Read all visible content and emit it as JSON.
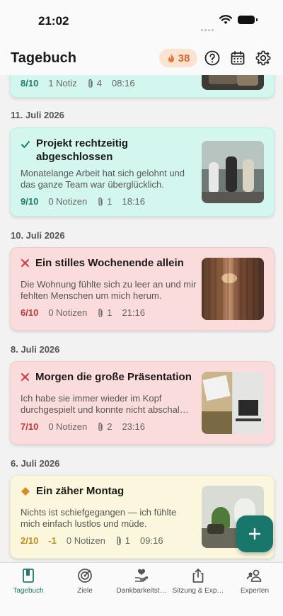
{
  "status_bar": {
    "time": "21:02"
  },
  "header": {
    "title": "Tagebuch",
    "streak_count": "38"
  },
  "entries": [
    {
      "title": "",
      "description": "",
      "score": "8/10",
      "notes": "1 Notiz",
      "attachments": "4",
      "time": "08:16",
      "mood": "positive"
    },
    {
      "date": "11. Juli 2026",
      "title": "Projekt rechtzeitig abgeschlossen",
      "description": "Monatelange Arbeit hat sich gelohnt und das ganze Team war überglücklich.",
      "score": "9/10",
      "notes": "0 Notizen",
      "attachments": "1",
      "time": "18:16",
      "mood": "positive"
    },
    {
      "date": "10. Juli 2026",
      "title": "Ein stilles Wochenende allein",
      "description": "Die Wohnung fühlte sich zu leer an und mir fehlten Menschen um mich herum.",
      "score": "6/10",
      "notes": "0 Notizen",
      "attachments": "1",
      "time": "21:16",
      "mood": "negative"
    },
    {
      "date": "8. Juli 2026",
      "title": "Morgen die große Präsentation",
      "description": "Ich habe sie immer wieder im Kopf durchgespielt und konnte nicht abschal…",
      "score": "7/10",
      "notes": "0 Notizen",
      "attachments": "2",
      "time": "23:16",
      "mood": "negative"
    },
    {
      "date": "6. Juli 2026",
      "title": "Ein zäher Montag",
      "description": "Nichts ist schiefgegangen — ich fühlte mich einfach lustlos und müde.",
      "score": "2/10",
      "delta": "-1",
      "notes": "0 Notizen",
      "attachments": "1",
      "time": "09:16",
      "mood": "neutral"
    }
  ],
  "tabs": [
    {
      "label": "Tagebuch",
      "icon": "journal-icon",
      "active": true
    },
    {
      "label": "Ziele",
      "icon": "target-icon"
    },
    {
      "label": "Dankbarkeitst…",
      "icon": "gratitude-hand-heart-icon"
    },
    {
      "label": "Sitzung & Exp…",
      "icon": "share-export-icon"
    },
    {
      "label": "Experten",
      "icon": "experts-people-icon"
    }
  ],
  "colors": {
    "accent": "#19766a",
    "positive_card": "#d3f6ee",
    "negative_card": "#fadcdc",
    "neutral_card": "#fbf7dd",
    "streak_bg": "#fbe3d2",
    "streak_text": "#d9682b"
  }
}
